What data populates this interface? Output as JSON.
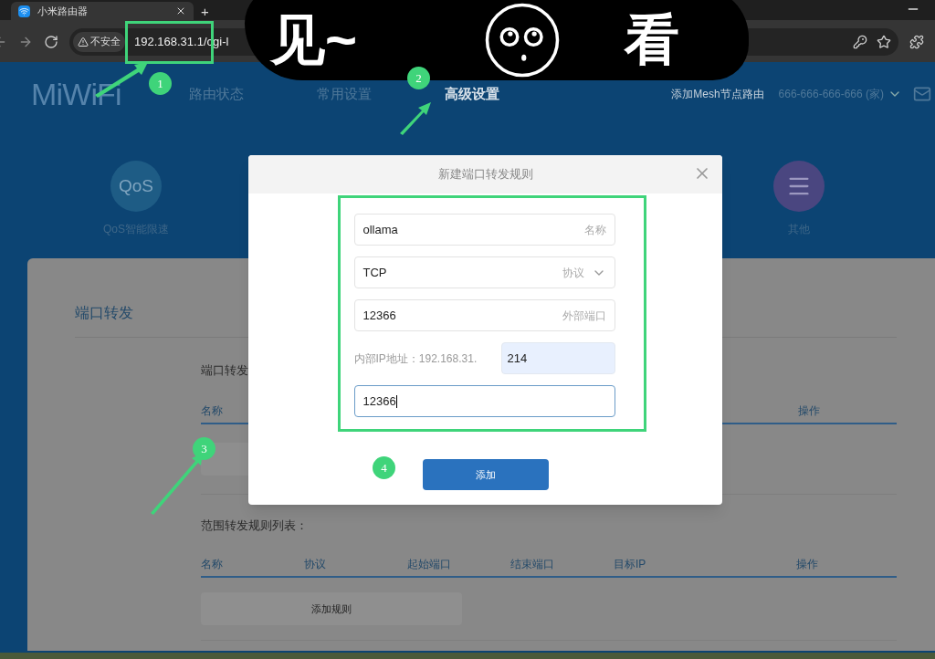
{
  "browser": {
    "tab_title": "小米路由器",
    "new_tab": "+",
    "security_label": "不安全",
    "url": "192.168.31.1/cgi-l"
  },
  "header": {
    "logo": "MiWiFi",
    "nav": [
      {
        "label": "路由状态",
        "selected": false
      },
      {
        "label": "常用设置",
        "selected": false
      },
      {
        "label": "高级设置",
        "selected": true
      }
    ],
    "mesh_link": "添加Mesh节点路由",
    "account": "666-666-666-666 (家)"
  },
  "features": [
    {
      "kind": "qos",
      "icon_text": "QoS",
      "label": "QoS智能限速",
      "color": "#1e5c85"
    },
    {
      "kind": "menu",
      "label": "其他",
      "color": "#4a4680"
    }
  ],
  "section": {
    "title": "端口转发",
    "subtitle": "端口转发",
    "table1_columns": [
      "名称",
      "操作"
    ],
    "table2_title": "范围转发规则列表：",
    "table2_columns": [
      "名称",
      "协议",
      "起始端口",
      "结束端口",
      "目标IP",
      "操作"
    ],
    "add_rule_button": "添加规则"
  },
  "dialog": {
    "title": "新建端口转发规则",
    "fields": [
      {
        "kind": "text",
        "value": "ollama",
        "label": "名称",
        "focused": false
      },
      {
        "kind": "select",
        "value": "TCP",
        "label": "协议",
        "focused": false
      },
      {
        "kind": "text",
        "value": "12366",
        "label": "外部端口",
        "focused": false
      },
      {
        "kind": "ip",
        "prefix": "内部IP地址：192.168.31.",
        "value": "214",
        "focused": false
      },
      {
        "kind": "text",
        "value": "12366",
        "focused": true
      }
    ],
    "submit": "添加"
  },
  "annotations": {
    "steps": [
      "1",
      "2",
      "3",
      "4"
    ],
    "sticker": [
      "见~",
      "看"
    ]
  }
}
